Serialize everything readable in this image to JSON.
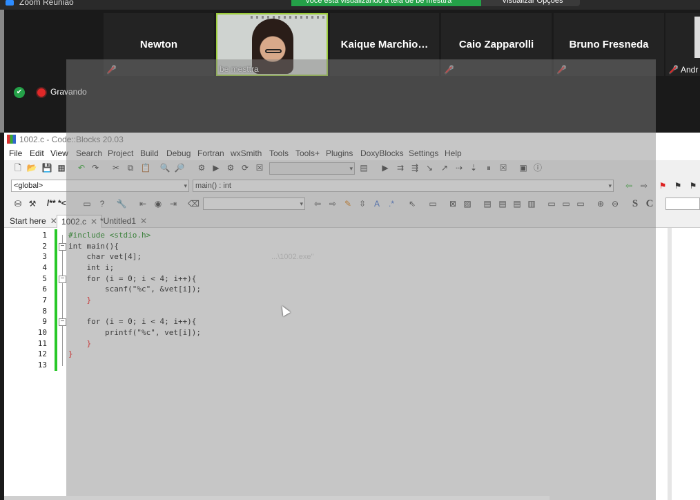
{
  "zoom": {
    "window_title": "Zoom Reunião",
    "share_banner": "Você está visualizando a tela de be mesttra",
    "view_options": "Visualizar Opções",
    "participants": [
      {
        "name": "Newton",
        "muted": true
      },
      {
        "name": "be mesttra",
        "video": true
      },
      {
        "name": "Kaique  Marchio…",
        "muted": false
      },
      {
        "name": "Caio Zapparolli",
        "muted": true
      },
      {
        "name": "Bruno Fresneda",
        "muted": true
      },
      {
        "name": "Andr",
        "muted": true
      }
    ],
    "recording_label": "Gravando"
  },
  "codeblocks": {
    "title": "1002.c - Code::Blocks 20.03",
    "menu": [
      "File",
      "Edit",
      "View",
      "Search",
      "Project",
      "Build",
      "Debug",
      "Fortran",
      "wxSmith",
      "Tools",
      "Tools+",
      "Plugins",
      "DoxyBlocks",
      "Settings",
      "Help"
    ],
    "scope_combo": "<global>",
    "function_combo": "main() : int",
    "doxy_label": "/** *<",
    "ghost_path": "...\\1002.exe\"",
    "tabs": [
      {
        "label": "Start here",
        "active": false
      },
      {
        "label": "1002.c",
        "active": true
      },
      {
        "label": "*Untitled1",
        "active": false
      }
    ],
    "code_lines": [
      "#include <stdio.h>",
      "int main(){",
      "    char vet[4];",
      "    int i;",
      "    for (i = 0; i < 4; i++){",
      "        scanf(\"%c\", &vet[i]);",
      "    }",
      "",
      "    for (i = 0; i < 4; i++){",
      "        printf(\"%c\", vet[i]);",
      "    }",
      "}",
      ""
    ],
    "line_numbers": [
      "1",
      "2",
      "3",
      "4",
      "5",
      "6",
      "7",
      "8",
      "9",
      "10",
      "11",
      "12",
      "13"
    ]
  },
  "colors": {
    "zoom_bg": "#1a1a1a",
    "active_speaker": "#9ccc3c",
    "muted": "#e02828",
    "changebar": "#28c828"
  }
}
